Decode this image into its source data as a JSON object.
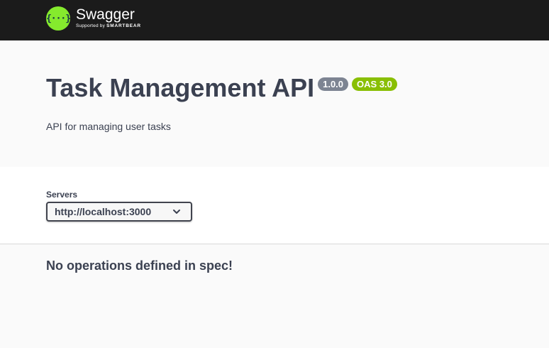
{
  "topbar": {
    "logo_glyph": "{···}",
    "logo_name": "Swagger",
    "logo_sub_prefix": "Supported by",
    "logo_sub_brand": "SMARTBEAR",
    "colors": {
      "background": "#1b1b1b",
      "logo_mark": "#85ea2d"
    }
  },
  "info": {
    "title": "Task Management API",
    "version_badge": "1.0.0",
    "oas_badge": "OAS 3.0",
    "description": "API for managing user tasks",
    "colors": {
      "version_badge": "#7d8492",
      "oas_badge": "#89bf04"
    }
  },
  "servers": {
    "label": "Servers",
    "selected": "http://localhost:3000",
    "dropdown_icon": "chevron-down-icon"
  },
  "operations": {
    "empty_message": "No operations defined in spec!"
  }
}
